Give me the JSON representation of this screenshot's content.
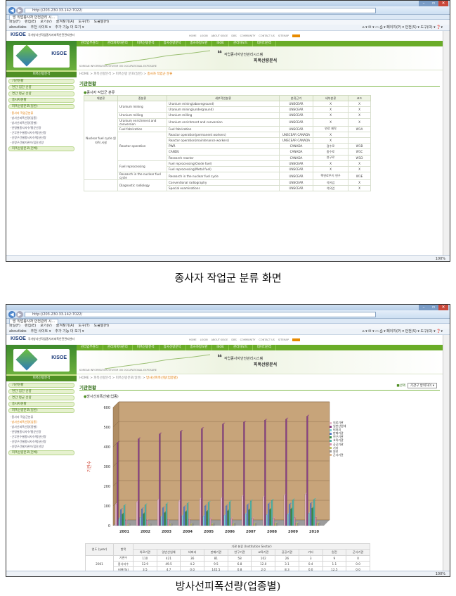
{
  "browser": {
    "url1": "http://203.230.33.142:7022/",
    "url2": "http://203.230.33.142:7022/",
    "tab1": "방 직업종사자 안전관리 시...",
    "tab2": "방 직업종사자 안전관리 시...",
    "menu": [
      "파일(F)",
      "편집(E)",
      "보기(V)",
      "즐겨찾기(A)",
      "도구(T)",
      "도움말(H)"
    ],
    "favorites": [
      "aboutlabs",
      "추천 사이트 ▾",
      "추가 기능 더 보기 ▾"
    ],
    "favright": "⌂ ▾ ✉ ▾ ▭ ⎙ ▾ 페이지(P) ▾ 안전(S) ▾ 도구(O) ▾ ❓▾",
    "zoom": "100%"
  },
  "site": {
    "logo": "KISOE",
    "logo_sub": "국가방사선작업종사자피폭안전관리센터",
    "toplinks": [
      "HOME",
      "LOGIN",
      "ABOUT KISOE",
      "DBS",
      "COMMUNITY",
      "CONTACT US",
      "SITEMAP"
    ],
    "toplinks_badge": "",
    "gnb": [
      "관리업무관리",
      "관리피폭자관리",
      "피폭선량분석",
      "방사선량분석",
      "종사자정보관",
      "ISOE",
      "관리자모드",
      "데이터관리"
    ],
    "left_logo": "KISOE",
    "left_title": "피폭선량분석",
    "left_menu": [
      "기관현황",
      "연간 집단 선량",
      "연간 평균 선량",
      "종사자현황",
      "피폭선량분포(일반)"
    ],
    "left_sub": [
      "· 종사자 작업군분류",
      "· 방사선피폭선량(업종)",
      "· 방사선피폭선량(종별)",
      "· 연령별종사자수/평균선량",
      "· 근무연수별종사자수/평균선량",
      "· 선량구간별종사자수/평균선량",
      "· 선량구간별기관수/집단선량"
    ],
    "left_menu2": "피폭선량분포(전체)",
    "banner_t1": "작업종사자안전관리시스템",
    "banner_t2": "피폭선량분석",
    "banner_eng": "KOREAN INFORMATION SYSTEM ON OCCUPATIONAL EXPOSURE"
  },
  "page1": {
    "crumb": "HOME > 피폭선량분석 > 피폭선량 분포(일반) >",
    "crumb_current": "종사자 작업군 분류",
    "title": "기관현황",
    "section": "종사자 작업군 분류",
    "headers": [
      "대분류",
      "중분류",
      "세부작업분류",
      "분류근거",
      "세부분류",
      "코드"
    ],
    "major": "Nuclear fuel cycle 원자력 시설",
    "rows": [
      {
        "mid": "Uranium mining",
        "span": 2,
        "detail": "Uranium mining(aboveground)",
        "basis": "UNSCEAR",
        "sub": "X",
        "code": "X"
      },
      {
        "mid": "",
        "span": 0,
        "detail": "Uranium mining(underground)",
        "basis": "UNSCEAR",
        "sub": "X",
        "code": "X"
      },
      {
        "mid": "Uranium milling",
        "span": 1,
        "detail": "Uranium milling",
        "basis": "UNSCEAR",
        "sub": "X",
        "code": "X"
      },
      {
        "mid": "Uranium enrichment and conversion",
        "span": 1,
        "detail": "Uranium enrichment and conversion",
        "basis": "UNSCEAR",
        "sub": "X",
        "code": "X"
      },
      {
        "mid": "Fuel fabrication",
        "span": 1,
        "detail": "Fuel fabrication",
        "basis": "UNSCEAR",
        "sub": "연료 제작",
        "code": "W1A"
      },
      {
        "mid": "Reactor operation",
        "span": 5,
        "detail": "Reactor operation(permanent workers)",
        "basis": "UNSCEAR CANADA",
        "sub": "X",
        "code": ""
      },
      {
        "mid": "",
        "span": 0,
        "detail": "Reactor operation(maintenance workers)",
        "basis": "UNSCEAR CANADA",
        "sub": "X",
        "code": ""
      },
      {
        "mid": "",
        "span": 0,
        "detail": "PWR",
        "basis": "CANADA",
        "sub": "경수로",
        "code": "W1B"
      },
      {
        "mid": "",
        "span": 0,
        "detail": "CANDU",
        "basis": "CANADA",
        "sub": "중수로",
        "code": "W1C"
      },
      {
        "mid": "",
        "span": 0,
        "detail": "Research reactor",
        "basis": "CANADA",
        "sub": "연구로",
        "code": "W1D"
      },
      {
        "mid": "Fuel reprocessing",
        "span": 2,
        "detail": "Fuel reprocessing(Oxide fuel)",
        "basis": "UNSCEAR",
        "sub": "X",
        "code": "X"
      },
      {
        "mid": "",
        "span": 0,
        "detail": "Fuel reprocessing(Metal fuel)",
        "basis": "UNSCEAR",
        "sub": "X",
        "code": "X"
      },
      {
        "mid": "Research in the nuclear fuel cycle",
        "span": 1,
        "detail": "Research in the nuclear fuel cycle",
        "basis": "UNSCEAR",
        "sub": "핵연료주기 연구",
        "code": "W1E"
      },
      {
        "mid": "Diagnostic radiology",
        "span": 2,
        "detail": "Conventional radiography",
        "basis": "UNSCEAR",
        "sub": "석유업",
        "code": "X"
      },
      {
        "mid": "",
        "span": 0,
        "detail": "Special examinations",
        "basis": "UNSCEAR",
        "sub": "석유업",
        "code": "X"
      }
    ]
  },
  "page2": {
    "crumb": "HOME > 피폭선량분석 > 피폭선량분포(일반) >",
    "crumb_current": "방사선피폭선량(업종별)",
    "title": "기관현황",
    "select_label": "선택",
    "select_value": "기관구 방위하이",
    "section": "방사선피폭선량(업종)",
    "table_headers": [
      "연도 (year)",
      "항목",
      "의료기관",
      "일반산업체",
      "비파괴",
      "판매기관",
      "연구기관",
      "교육기관",
      "공공기관",
      "기타",
      "원전",
      "군사기관"
    ],
    "sector_header": "기관 분류 (Institution Sector)",
    "table_year": "2001",
    "table_rows": [
      {
        "label": "기관수",
        "values": [
          "110",
          "421",
          "36",
          "81",
          "58",
          "102",
          "26",
          "3",
          "9",
          "0"
        ]
      },
      {
        "label": "종사자수",
        "values": [
          "12.9",
          "49.5",
          "4.2",
          "9.5",
          "6.8",
          "12.0",
          "3.1",
          "0.4",
          "1.1",
          "0.0"
        ]
      },
      {
        "label": "비율(%)",
        "values": [
          "3.5",
          "4.7",
          "0.0",
          "145.5",
          "0.8",
          "2.0",
          "8.3",
          "0.0",
          "12.5",
          "0.0"
        ]
      }
    ]
  },
  "chart_data": {
    "type": "bar",
    "ylabel": "기관수",
    "ylim": [
      0,
      600
    ],
    "yticks": [
      0,
      100,
      200,
      300,
      400,
      500,
      600
    ],
    "categories": [
      "2001",
      "2002",
      "2003",
      "2004",
      "2005",
      "2006",
      "2007",
      "2008",
      "2009",
      "2010"
    ],
    "series": [
      {
        "name": "의료기관",
        "color": "#e6b8c8",
        "values": [
          110,
          120,
          130,
          125,
          135,
          140,
          150,
          145,
          155,
          160
        ]
      },
      {
        "name": "일반산업체",
        "color": "#8a3f86",
        "values": [
          421,
          440,
          465,
          478,
          492,
          515,
          525,
          535,
          540,
          555
        ]
      },
      {
        "name": "비파괴",
        "color": "#7ed0d8",
        "values": [
          36,
          40,
          45,
          50,
          48,
          52,
          60,
          55,
          58,
          62
        ]
      },
      {
        "name": "판매기관",
        "color": "#5a7ec8",
        "values": [
          81,
          85,
          90,
          95,
          100,
          100,
          105,
          110,
          108,
          112
        ]
      },
      {
        "name": "연구기관",
        "color": "#2f8f4a",
        "values": [
          58,
          60,
          65,
          70,
          72,
          75,
          80,
          82,
          85,
          88
        ]
      },
      {
        "name": "교육기관",
        "color": "#4fb5a8",
        "values": [
          102,
          105,
          110,
          112,
          118,
          120,
          125,
          128,
          130,
          132
        ]
      },
      {
        "name": "공공기관",
        "color": "#d88fb0",
        "values": [
          26,
          28,
          30,
          32,
          34,
          35,
          36,
          38,
          40,
          42
        ]
      },
      {
        "name": "기타",
        "color": "#c0c060",
        "values": [
          3,
          4,
          5,
          6,
          7,
          8,
          9,
          10,
          11,
          12
        ]
      },
      {
        "name": "원전",
        "color": "#9a9a9a",
        "values": [
          9,
          9,
          9,
          10,
          10,
          11,
          11,
          12,
          12,
          12
        ]
      },
      {
        "name": "군사기관",
        "color": "#d9b48f",
        "values": [
          0,
          0,
          0,
          0,
          0,
          0,
          0,
          0,
          0,
          0
        ]
      }
    ],
    "legend": "right",
    "grid": true
  },
  "captions": {
    "c1": "종사자 작업군 분류 화면",
    "c2": "방사선피폭선량(업종별)"
  }
}
